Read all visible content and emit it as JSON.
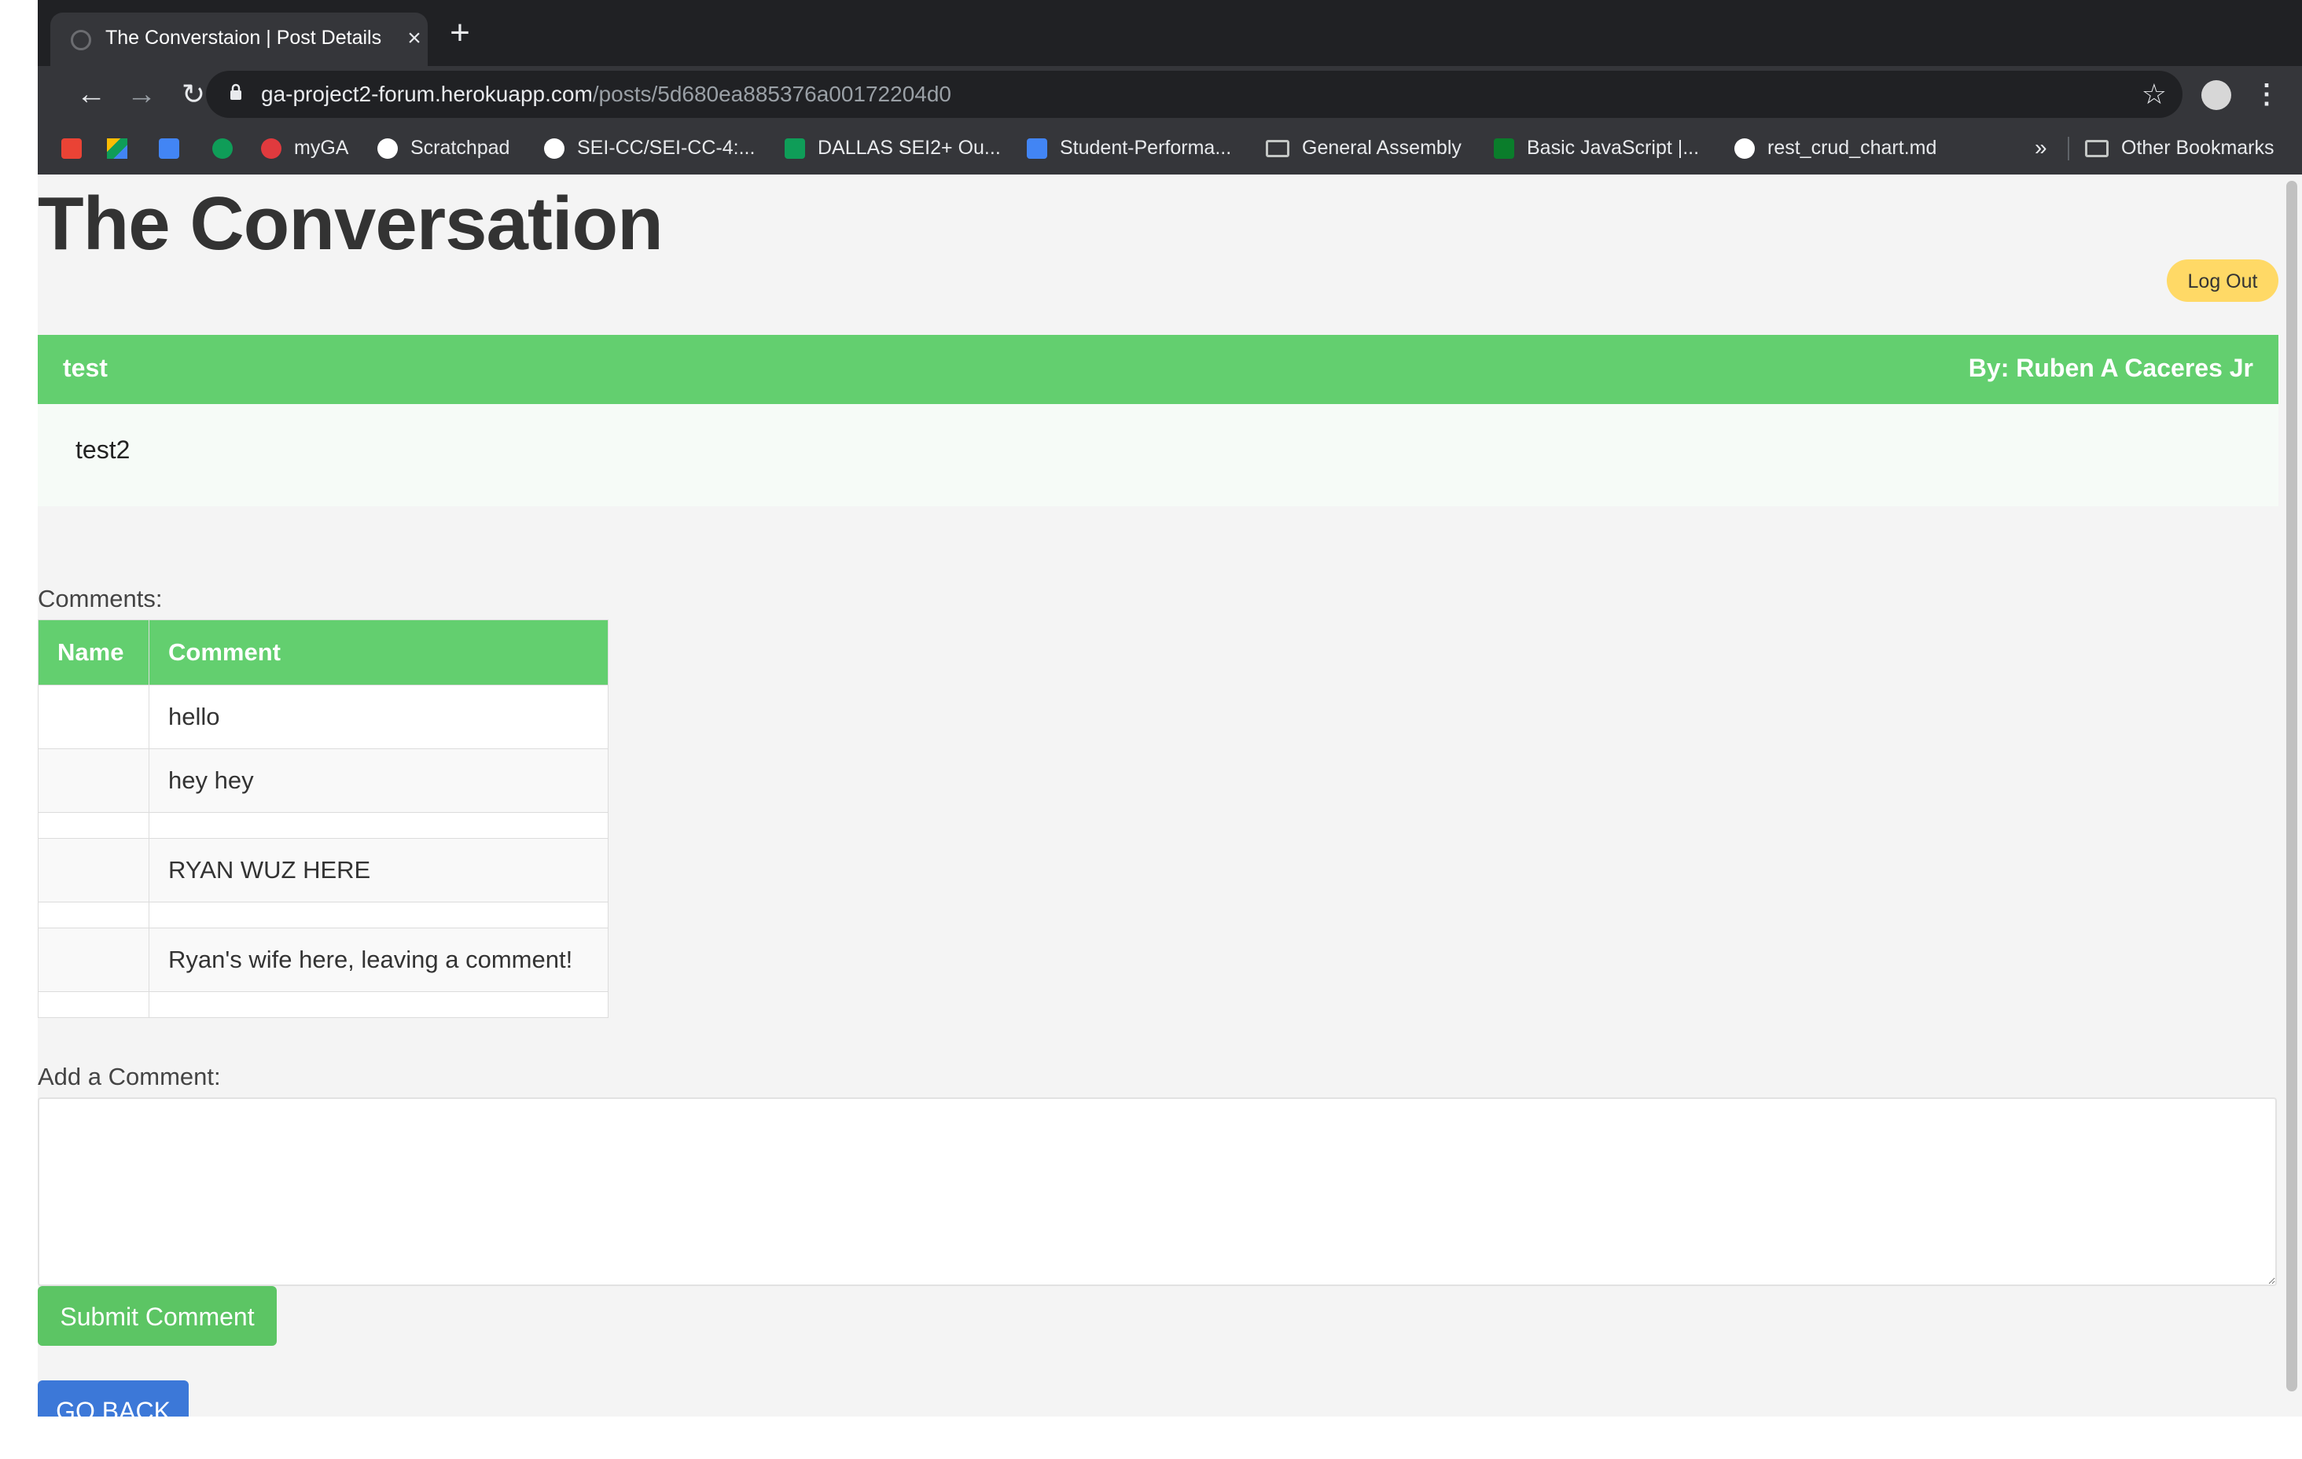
{
  "browser": {
    "tab_title": "The Converstaion | Post Details",
    "url_host": "ga-project2-forum.herokuapp.com",
    "url_path": "/posts/5d680ea885376a00172204d0",
    "more_bookmarks": "»",
    "bookmarks": [
      {
        "label": "",
        "icon": "gmail-icon",
        "color": "#ea4335"
      },
      {
        "label": "",
        "icon": "drive-icon",
        "color": "#fbbc04"
      },
      {
        "label": "",
        "icon": "calendar-icon",
        "color": "#4285f4"
      },
      {
        "label": "",
        "icon": "hangouts-icon",
        "color": "#0f9d58"
      },
      {
        "label": "myGA",
        "icon": "ga-icon",
        "color": "#e03a3e"
      },
      {
        "label": "Scratchpad",
        "icon": "globe-icon",
        "color": "#ffffff"
      },
      {
        "label": "SEI-CC/SEI-CC-4:...",
        "icon": "github-icon",
        "color": "#ffffff"
      },
      {
        "label": "DALLAS SEI2+ Ou...",
        "icon": "sheets-icon",
        "color": "#0f9d58"
      },
      {
        "label": "Student-Performa...",
        "icon": "docs-icon",
        "color": "#4285f4"
      },
      {
        "label": "General Assembly",
        "icon": "folder-icon",
        "color": "#c4c7c5"
      },
      {
        "label": "Basic JavaScript |...",
        "icon": "fcc-icon",
        "color": "#0a7d2b"
      },
      {
        "label": "rest_crud_chart.md",
        "icon": "github-icon",
        "color": "#ffffff"
      }
    ],
    "other_bookmarks": "Other Bookmarks"
  },
  "page": {
    "site_title": "The Conversation",
    "logout_label": "Log Out",
    "post": {
      "title": "test",
      "author": "By: Ruben A Caceres Jr",
      "body": "test2"
    },
    "comments_label": "Comments:",
    "table_headers": {
      "name": "Name",
      "comment": "Comment"
    },
    "comments": [
      {
        "name": "",
        "comment": "hello"
      },
      {
        "name": "",
        "comment": "hey hey"
      },
      {
        "name": "",
        "comment": ""
      },
      {
        "name": "",
        "comment": "RYAN WUZ HERE"
      },
      {
        "name": "",
        "comment": ""
      },
      {
        "name": "",
        "comment": "Ryan's wife here, leaving a comment!"
      },
      {
        "name": "",
        "comment": ""
      }
    ],
    "add_comment_label": "Add a Comment:",
    "submit_label": "Submit Comment",
    "go_back_label": "GO BACK"
  }
}
